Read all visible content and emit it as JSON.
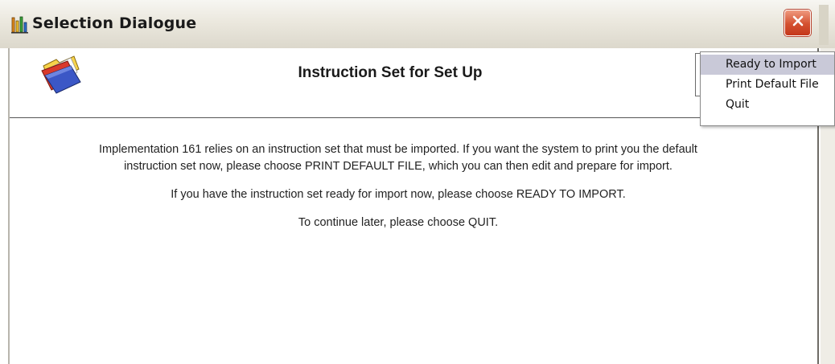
{
  "window": {
    "title": "Selection Dialogue",
    "title_icon": "app-bars-icon",
    "close_icon": "close-x-icon"
  },
  "header": {
    "icon": "open-folder-icon",
    "title": "Instruction Set for Set Up"
  },
  "body": {
    "paragraph1": "Implementation 161 relies on an instruction set that must be imported. If you want the system to print you the default instruction set now, please choose PRINT DEFAULT FILE, which you can then edit and prepare for import.",
    "paragraph2": "If you have the instruction set ready for import now, please choose READY TO IMPORT.",
    "paragraph3": "To continue later, please choose QUIT."
  },
  "menu": {
    "items": [
      {
        "label": "Ready to Import",
        "highlighted": true
      },
      {
        "label": "Print Default File",
        "highlighted": false
      },
      {
        "label": "Quit",
        "highlighted": false
      }
    ]
  },
  "colors": {
    "close_button": "#d4502f",
    "menu_highlight": "#c9c9d8",
    "titlebar": "#ebe8de"
  }
}
